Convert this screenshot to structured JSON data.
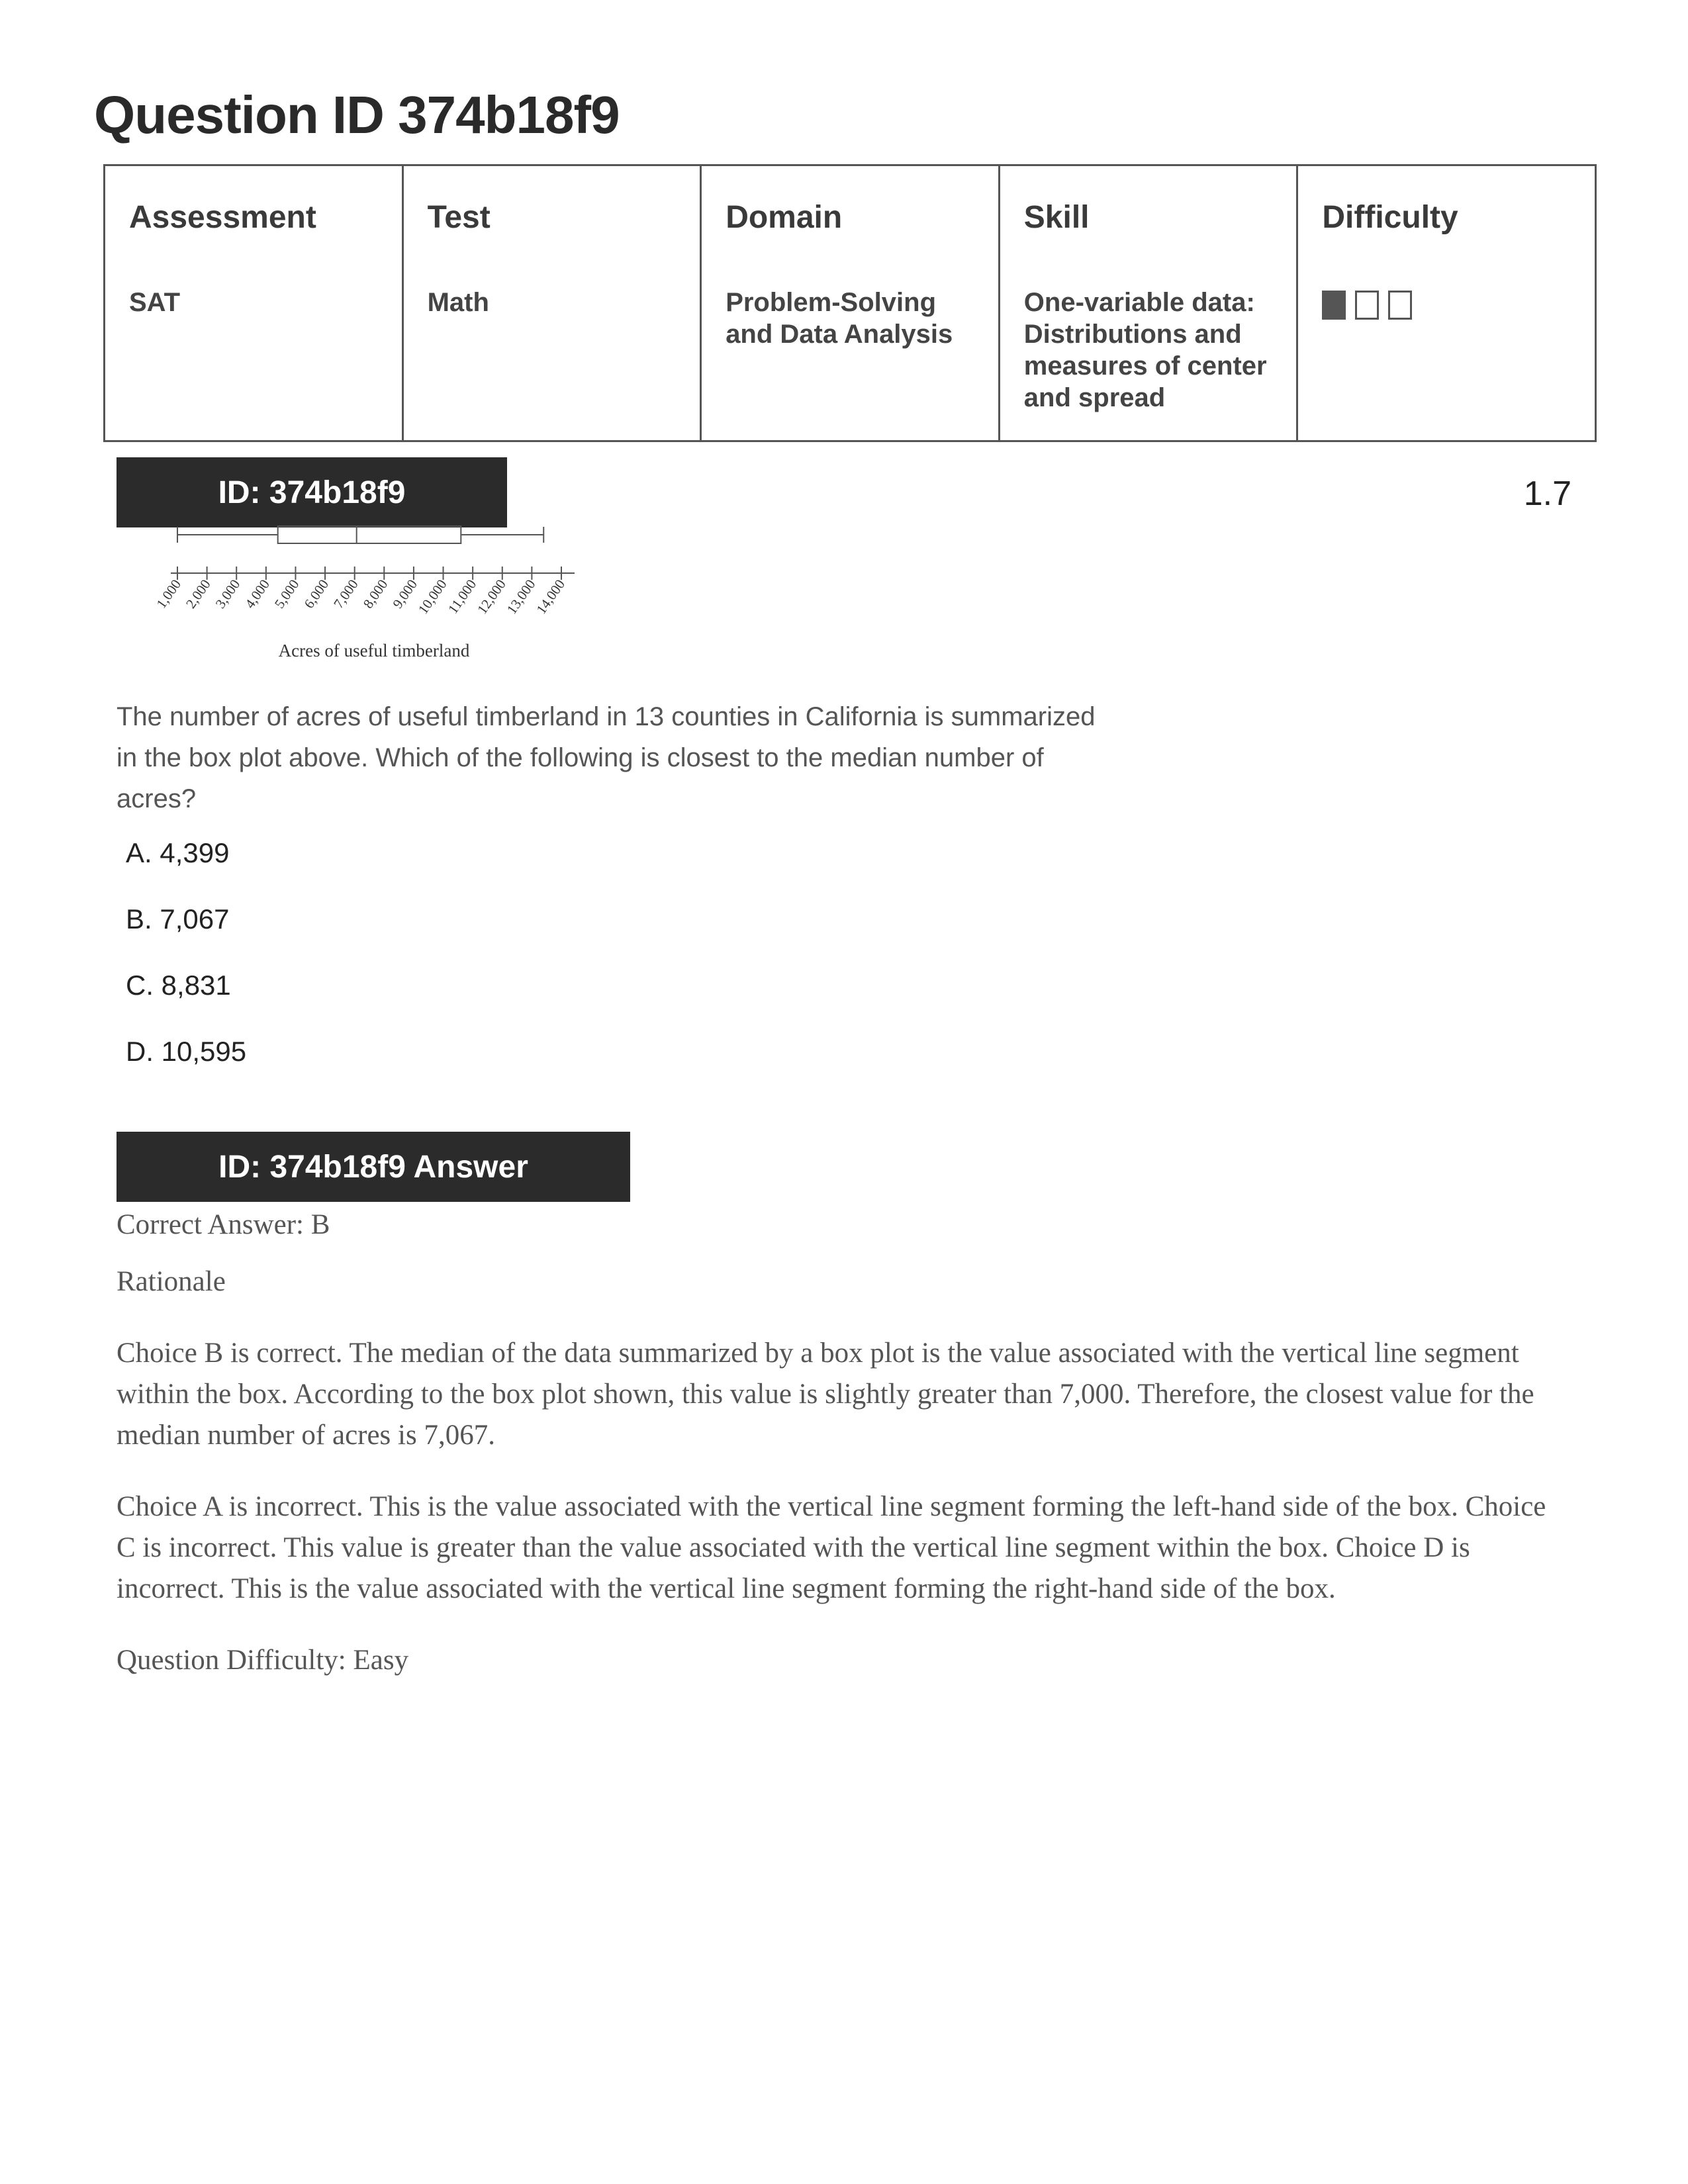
{
  "page": {
    "title": "Question ID 374b18f9"
  },
  "meta": {
    "headers": [
      "Assessment",
      "Test",
      "Domain",
      "Skill",
      "Difficulty"
    ],
    "values": {
      "assessment": "SAT",
      "test": "Math",
      "domain": "Problem-Solving and Data Analysis",
      "skill": "One-variable data: Distributions and measures of center and spread"
    },
    "difficulty_level": 1,
    "difficulty_max": 3
  },
  "question_banner": "ID: 374b18f9",
  "score": "1.7",
  "figure": {
    "xlabel": "Acres of useful timberland",
    "ticks": [
      "1,000",
      "2,000",
      "3,000",
      "4,000",
      "5,000",
      "6,000",
      "7,000",
      "8,000",
      "9,000",
      "10,000",
      "11,000",
      "12,000",
      "13,000",
      "14,000"
    ]
  },
  "chart_data": {
    "type": "boxplot",
    "xlabel": "Acres of useful timberland",
    "xlim": [
      1000,
      14000
    ],
    "min": 1000,
    "q1": 4400,
    "median": 7067,
    "q3": 10600,
    "max": 13400
  },
  "question": "The number of acres of useful timberland in 13 counties in California is summarized in the box plot above. Which of the following is closest to the median number of acres?",
  "choices": [
    "A. 4,399",
    "B. 7,067",
    "C. 8,831",
    "D. 10,595"
  ],
  "answer_banner": "ID: 374b18f9 Answer",
  "answer": {
    "correct": "Correct Answer: B",
    "rationale_label": "Rationale",
    "paragraph1": "Choice B is correct. The median of the data summarized by a box plot is the value associated with the vertical line segment within the box. According to the box plot shown, this value is slightly greater than 7,000. Therefore, the closest value for the median number of acres is 7,067.",
    "paragraph2": "Choice A is incorrect. This is the value associated with the vertical line segment forming the left-hand side of the box. Choice C is incorrect. This value is greater than the value associated with the vertical line segment within the box. Choice D is incorrect. This is the value associated with the vertical line segment forming the right-hand side of the box.",
    "difficulty": "Question Difficulty: Easy"
  }
}
